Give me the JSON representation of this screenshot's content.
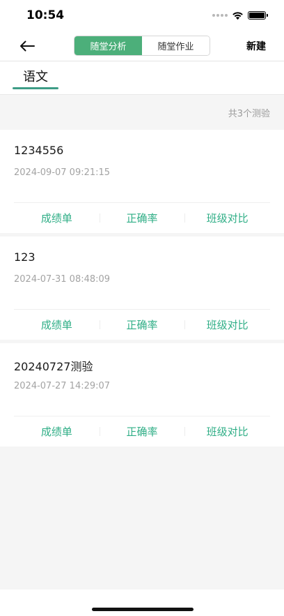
{
  "status_bar": {
    "time": "10:54"
  },
  "nav": {
    "back_icon": "arrow-left-icon",
    "segments": [
      {
        "label": "随堂分析",
        "active": true
      },
      {
        "label": "随堂作业",
        "active": false
      }
    ],
    "new_label": "新建"
  },
  "subject": {
    "tab_label": "语文"
  },
  "summary": {
    "count_text": "共3个测验"
  },
  "cards": [
    {
      "title": "1234556",
      "time": "2024-09-07 09:21:15",
      "actions": [
        "成绩单",
        "正确率",
        "班级对比"
      ]
    },
    {
      "title": "123",
      "time": "2024-07-31 08:48:09",
      "actions": [
        "成绩单",
        "正确率",
        "班级对比"
      ]
    },
    {
      "title": "20240727测验",
      "time": "2024-07-27 14:29:07",
      "actions": [
        "成绩单",
        "正确率",
        "班级对比"
      ]
    }
  ],
  "colors": {
    "accent": "#4caf7a",
    "action_text": "#2fae86",
    "underline": "#3d9c86"
  }
}
